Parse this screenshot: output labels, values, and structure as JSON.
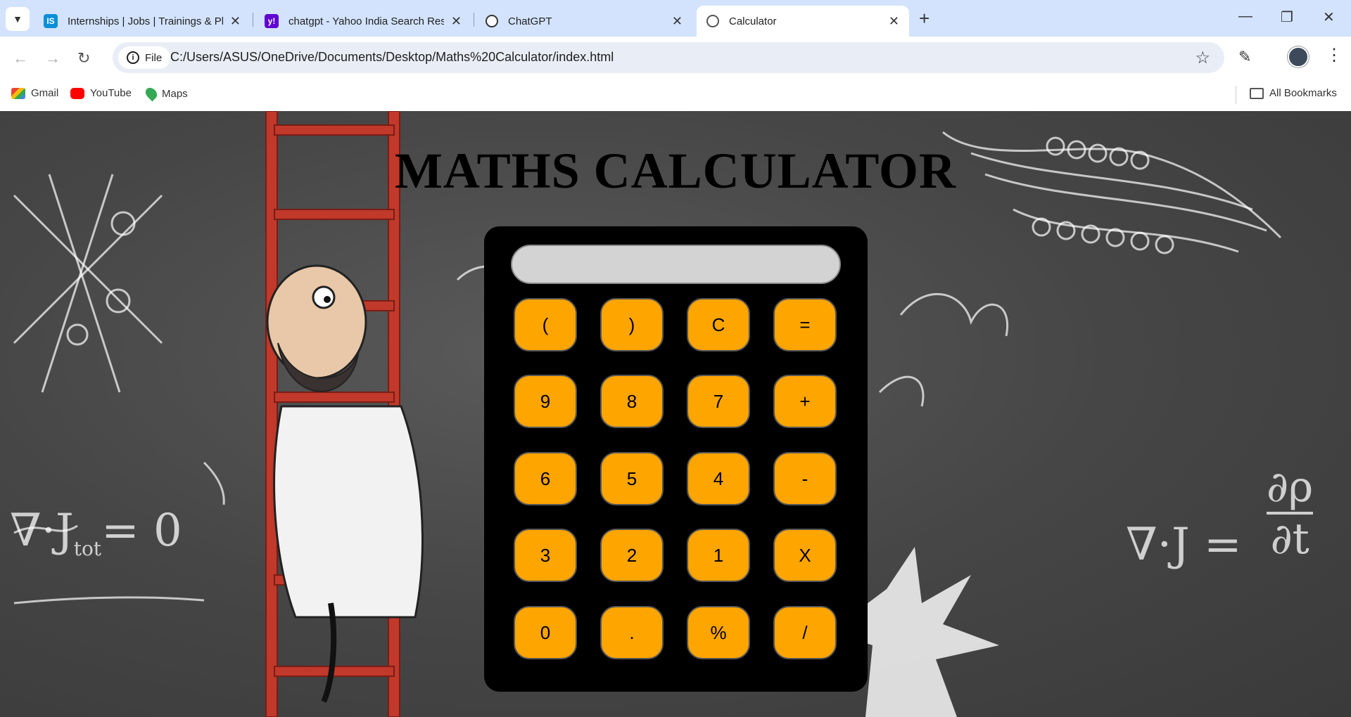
{
  "tabs": [
    {
      "title": "Internships | Jobs | Trainings & Pla",
      "favicon": "internshala-icon",
      "active": false
    },
    {
      "title": "chatgpt - Yahoo India Search Resu",
      "favicon": "yahoo-icon",
      "active": false
    },
    {
      "title": "ChatGPT",
      "favicon": "chatgpt-icon",
      "active": false
    },
    {
      "title": "Calculator",
      "favicon": "globe-icon",
      "active": true
    }
  ],
  "address_bar": {
    "scheme_chip": "File",
    "url": "C:/Users/ASUS/OneDrive/Documents/Desktop/Maths%20Calculator/index.html"
  },
  "bookmarks": {
    "items": [
      {
        "label": "Gmail",
        "icon": "gmail-icon"
      },
      {
        "label": "YouTube",
        "icon": "youtube-icon"
      },
      {
        "label": "Maps",
        "icon": "maps-icon"
      }
    ],
    "all_bookmarks": "All Bookmarks"
  },
  "page": {
    "heading": "MATHS CALCULATOR",
    "display_value": "",
    "keys": [
      [
        "(",
        ")",
        "C",
        "="
      ],
      [
        "9",
        "8",
        "7",
        "+"
      ],
      [
        "6",
        "5",
        "4",
        "-"
      ],
      [
        "3",
        "2",
        "1",
        "X"
      ],
      [
        "0",
        ".",
        "%",
        "/"
      ]
    ],
    "chalk": {
      "formula_left_main": "∇·J",
      "formula_left_sub": "tot",
      "formula_left_rhs": "= 0",
      "formula_right": "∇·J =",
      "formula_right_frac_top": "∂ρ",
      "formula_right_frac_bottom": "∂t"
    }
  },
  "colors": {
    "key_bg": "#ffa500",
    "calc_body": "#000000",
    "display_bg": "#d3d3d3",
    "tab_strip": "#d3e3fd"
  }
}
